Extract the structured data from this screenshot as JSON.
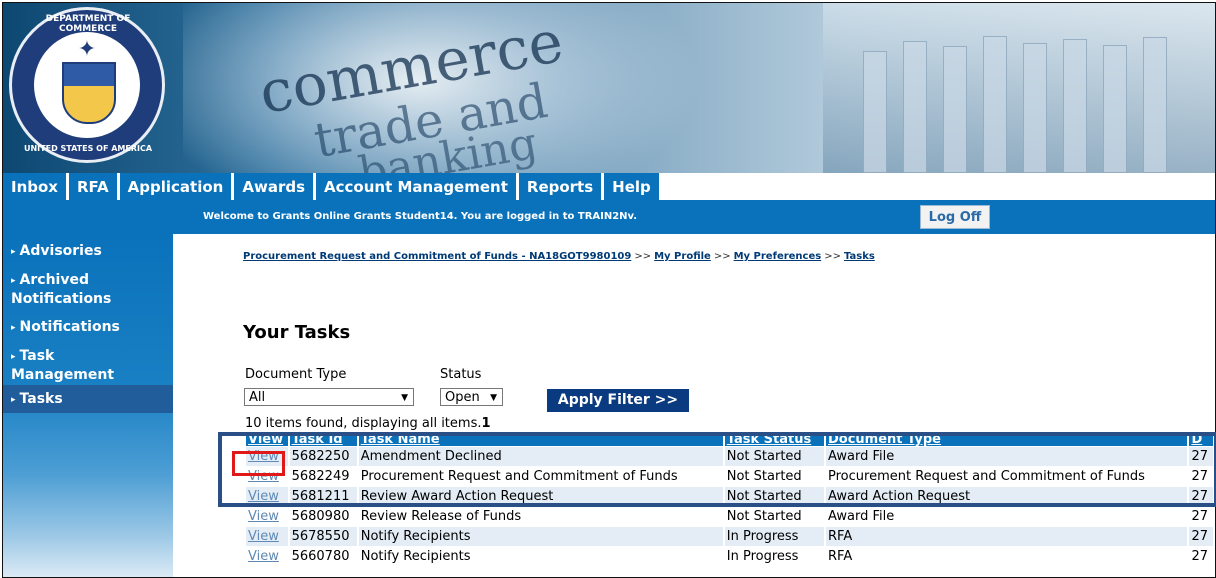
{
  "banner": {
    "seal_top_text": "DEPARTMENT OF COMMERCE",
    "seal_bottom_text": "UNITED STATES OF AMERICA",
    "background_words": [
      "commerce",
      "trade and",
      "banking"
    ]
  },
  "nav": {
    "tabs": [
      "Inbox",
      "RFA",
      "Application",
      "Awards",
      "Account Management",
      "Reports",
      "Help"
    ]
  },
  "header": {
    "welcome": "Welcome to Grants Online Grants Student14. You are logged in to TRAIN2Nv.",
    "logoff_label": "Log Off"
  },
  "sidebar": {
    "items": [
      {
        "label": "Advisories"
      },
      {
        "label": "Archived Notifications"
      },
      {
        "label": "Notifications"
      },
      {
        "label": "Task Management"
      },
      {
        "label": "Tasks",
        "active": true
      }
    ]
  },
  "breadcrumb": {
    "items": [
      "Procurement Request and Commitment of Funds - NA18GOT9980109",
      "My Profile",
      "My Preferences",
      "Tasks"
    ],
    "separator": ">>"
  },
  "page": {
    "title": "Your Tasks",
    "filters": {
      "document_type_label": "Document Type",
      "document_type_value": "All",
      "status_label": "Status",
      "status_value": "Open",
      "apply_label": "Apply Filter >>"
    },
    "summary": "10 items found, displaying all items.",
    "summary_page": "1"
  },
  "table": {
    "columns": [
      "View",
      "Task Id",
      "Task Name",
      "Task Status",
      "Document Type",
      "D"
    ],
    "rows": [
      {
        "view": "View",
        "id": "5682250",
        "name": "Amendment Declined",
        "status": "Not Started",
        "doc_type": "Award File",
        "d": "27"
      },
      {
        "view": "View",
        "id": "5682249",
        "name": "Procurement Request and Commitment of Funds",
        "status": "Not Started",
        "doc_type": "Procurement Request and Commitment of Funds",
        "d": "27"
      },
      {
        "view": "View",
        "id": "5681211",
        "name": "Review Award Action Request",
        "status": "Not Started",
        "doc_type": "Award Action Request",
        "d": "27"
      },
      {
        "view": "View",
        "id": "5680980",
        "name": "Review Release of Funds",
        "status": "Not Started",
        "doc_type": "Award File",
        "d": "27"
      },
      {
        "view": "View",
        "id": "5678550",
        "name": "Notify Recipients",
        "status": "In Progress",
        "doc_type": "RFA",
        "d": "27"
      },
      {
        "view": "View",
        "id": "5660780",
        "name": "Notify Recipients",
        "status": "In Progress",
        "doc_type": "RFA",
        "d": "27"
      }
    ]
  },
  "colors": {
    "nav_blue": "#0a72bb",
    "dark_blue": "#0a3a80",
    "highlight_blue": "#2a4f86",
    "highlight_red": "#e01818"
  }
}
